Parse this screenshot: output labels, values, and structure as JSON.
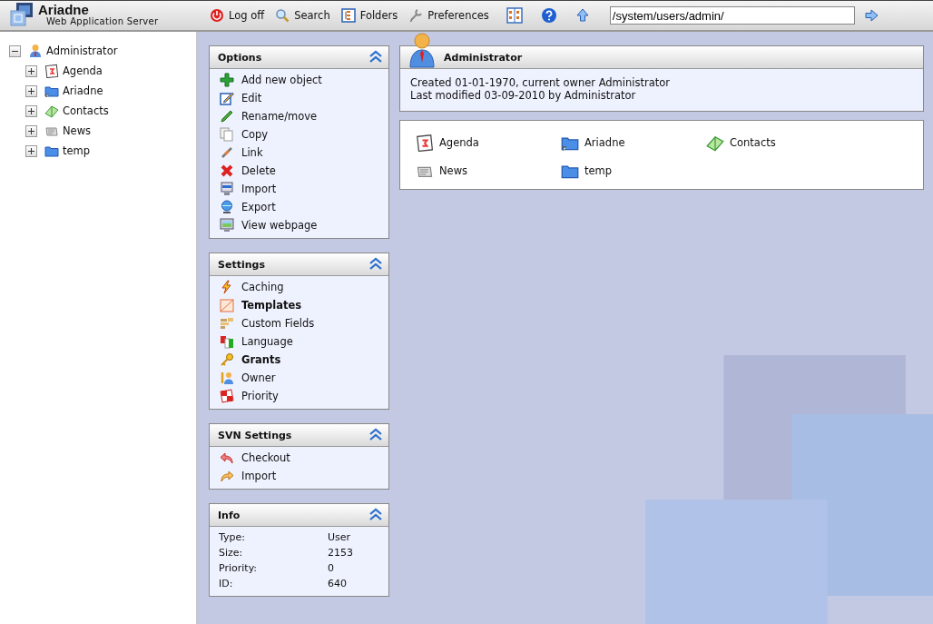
{
  "app": {
    "title": "Ariadne",
    "subtitle": "Web Application Server"
  },
  "toolbar": {
    "buttons": [
      {
        "label": "Log off"
      },
      {
        "label": "Search"
      },
      {
        "label": "Folders"
      },
      {
        "label": "Preferences"
      }
    ],
    "address": {
      "value": "/system/users/admin/"
    }
  },
  "tree": {
    "label": "Administrator",
    "expanded": true,
    "children": [
      {
        "label": "Agenda",
        "expanded": false
      },
      {
        "label": "Ariadne",
        "expanded": false
      },
      {
        "label": "Contacts",
        "expanded": false
      },
      {
        "label": "News",
        "expanded": false
      },
      {
        "label": "temp",
        "expanded": false
      }
    ]
  },
  "panels": [
    {
      "title": "Options",
      "expanded": true,
      "items": [
        {
          "label": "Add new object",
          "emphasized": false
        },
        {
          "label": "Edit",
          "emphasized": false
        },
        {
          "label": "Rename/move",
          "emphasized": false
        },
        {
          "label": "Copy",
          "emphasized": false
        },
        {
          "label": "Link",
          "emphasized": false
        },
        {
          "label": "Delete",
          "emphasized": false
        },
        {
          "label": "Import",
          "emphasized": false
        },
        {
          "label": "Export",
          "emphasized": false
        },
        {
          "label": "View webpage",
          "emphasized": false
        }
      ]
    },
    {
      "title": "Settings",
      "expanded": true,
      "items": [
        {
          "label": "Caching",
          "emphasized": false
        },
        {
          "label": "Templates",
          "emphasized": true
        },
        {
          "label": "Custom Fields",
          "emphasized": false
        },
        {
          "label": "Language",
          "emphasized": false
        },
        {
          "label": "Grants",
          "emphasized": true
        },
        {
          "label": "Owner",
          "emphasized": false
        },
        {
          "label": "Priority",
          "emphasized": false
        }
      ]
    },
    {
      "title": "SVN Settings",
      "expanded": true,
      "items": [
        {
          "label": "Checkout",
          "emphasized": false
        },
        {
          "label": "Import",
          "emphasized": false
        }
      ]
    },
    {
      "title": "Info",
      "expanded": true,
      "fields": [
        {
          "label": "Type:",
          "value": "User"
        },
        {
          "label": "Size:",
          "value": "2153"
        },
        {
          "label": "Priority:",
          "value": "0"
        },
        {
          "label": "ID:",
          "value": "640"
        }
      ]
    }
  ],
  "object": {
    "title": "Administrator",
    "lines": [
      "Created 01-01-1970, current owner Administrator",
      "Last modified 03-09-2010 by Administrator"
    ]
  },
  "children": [
    {
      "label": "Agenda"
    },
    {
      "label": "Ariadne"
    },
    {
      "label": "Contacts"
    },
    {
      "label": "News"
    },
    {
      "label": "temp"
    }
  ]
}
